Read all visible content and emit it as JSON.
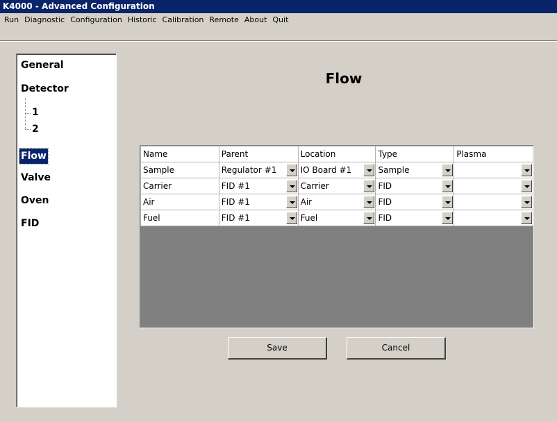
{
  "window": {
    "title": "K4000 - Advanced Configuration"
  },
  "menu": [
    "Run",
    "Diagnostic",
    "Configuration",
    "Historic",
    "Calibration",
    "Remote",
    "About",
    "Quit"
  ],
  "tree": {
    "items": [
      {
        "label": "General",
        "selected": false
      },
      {
        "label": "Detector",
        "selected": false
      },
      {
        "label": "1",
        "selected": false
      },
      {
        "label": "2",
        "selected": false
      },
      {
        "label": "Flow",
        "selected": true
      },
      {
        "label": "Valve",
        "selected": false
      },
      {
        "label": "Oven",
        "selected": false
      },
      {
        "label": "FID",
        "selected": false
      }
    ]
  },
  "page": {
    "title": "Flow"
  },
  "table": {
    "columns": [
      "Name",
      "Parent",
      "Location",
      "Type",
      "Plasma"
    ],
    "rows": [
      [
        "Sample",
        "Regulator #1",
        "IO Board #1",
        "Sample",
        ""
      ],
      [
        "Carrier",
        "FID #1",
        "Carrier",
        "FID",
        ""
      ],
      [
        "Air",
        "FID #1",
        "Air",
        "FID",
        ""
      ],
      [
        "Fuel",
        "FID #1",
        "Fuel",
        "FID",
        ""
      ]
    ]
  },
  "buttons": {
    "save": "Save",
    "cancel": "Cancel"
  }
}
